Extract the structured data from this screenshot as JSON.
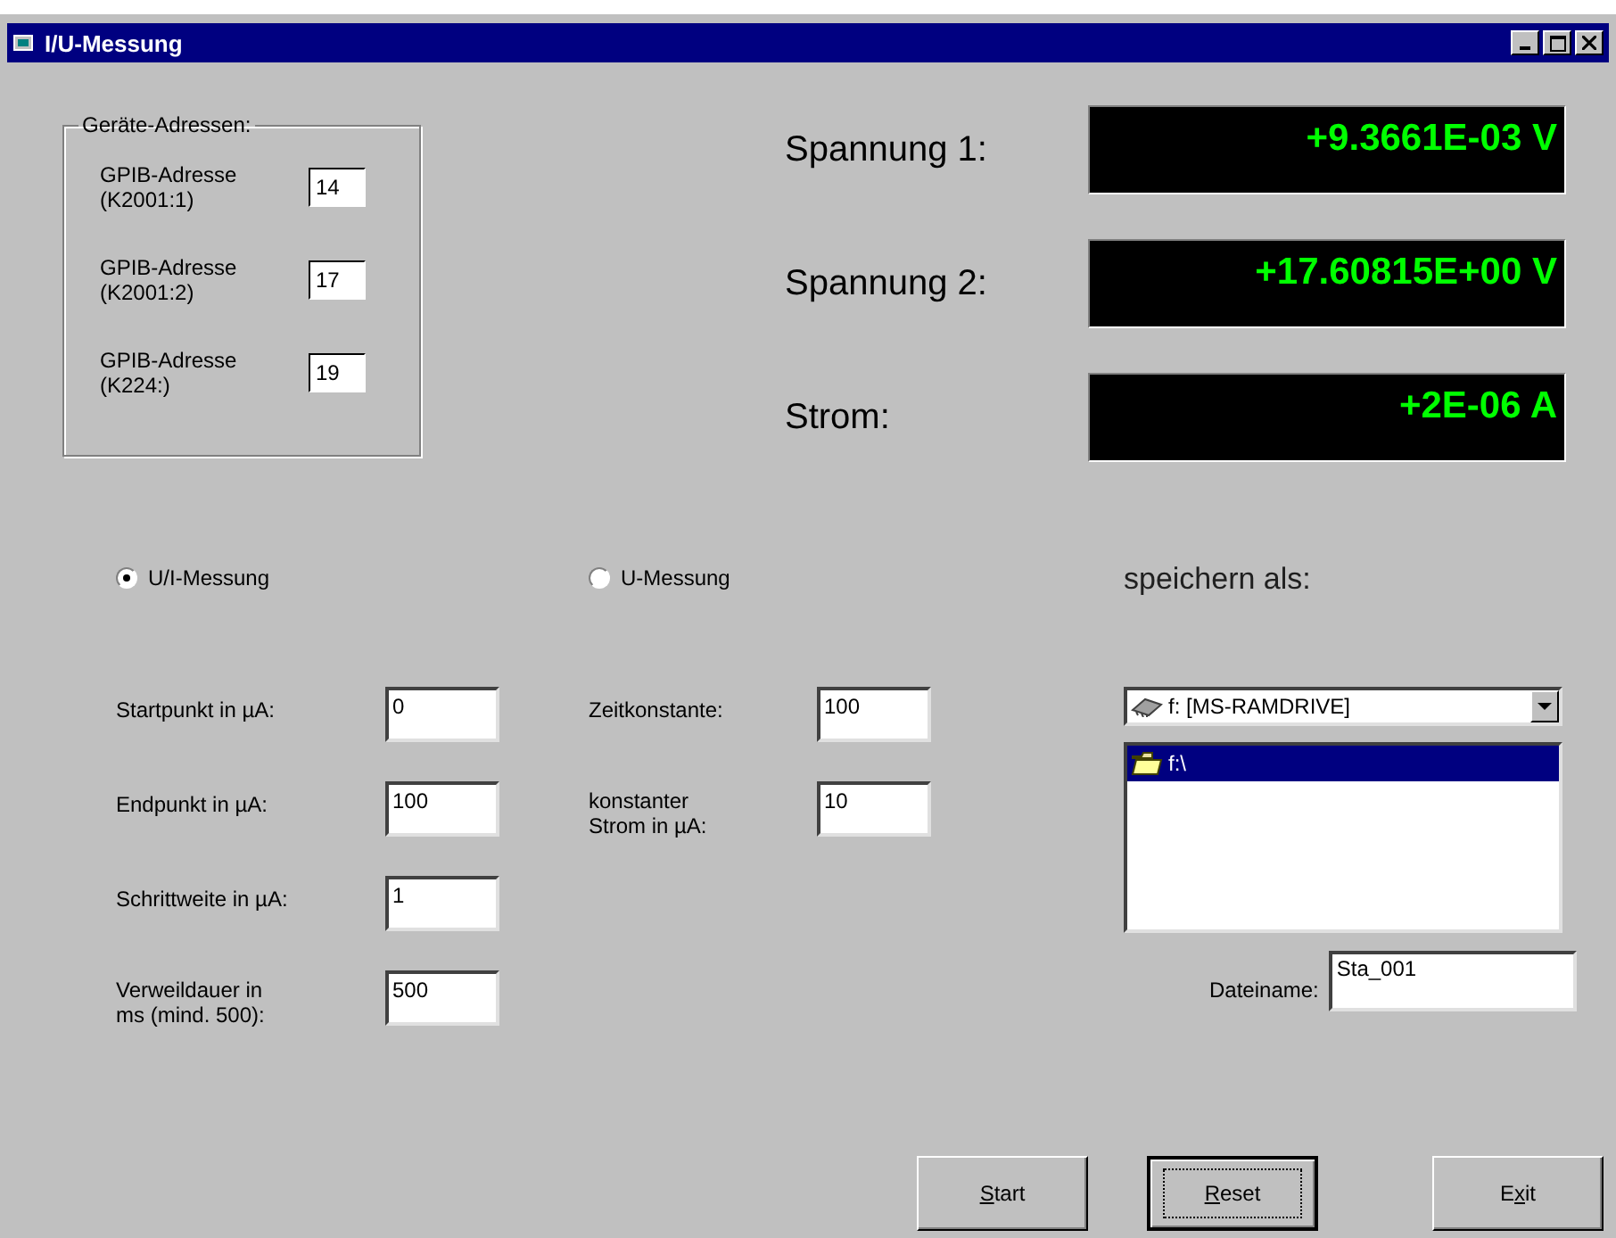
{
  "window": {
    "title": "I/U-Messung"
  },
  "device_addresses": {
    "legend": "Geräte-Adressen:",
    "items": [
      {
        "label_line1": "GPIB-Adresse",
        "label_line2": "(K2001:1)",
        "value": "14"
      },
      {
        "label_line1": "GPIB-Adresse",
        "label_line2": "(K2001:2)",
        "value": "17"
      },
      {
        "label_line1": "GPIB-Adresse",
        "label_line2": "(K224:)",
        "value": "19"
      }
    ]
  },
  "readings": [
    {
      "label": "Spannung 1:",
      "value": "+9.3661E-03 V"
    },
    {
      "label": "Spannung 2:",
      "value": "+17.60815E+00 V"
    },
    {
      "label": "Strom:",
      "value": "+2E-06 A"
    }
  ],
  "modes": [
    {
      "label": "U/I-Messung",
      "selected": true,
      "fields": [
        {
          "kind": "single",
          "label": "Startpunkt in µA:",
          "value": "0"
        },
        {
          "kind": "single",
          "label": "Endpunkt in µA:",
          "value": "100"
        },
        {
          "kind": "single",
          "label": "Schrittweite in µA:",
          "value": "1"
        },
        {
          "kind": "wrapped",
          "label": "Verweildauer in ms  (mind. 500):",
          "value": "500"
        }
      ]
    },
    {
      "label": "U-Messung",
      "selected": false,
      "fields": [
        {
          "kind": "single",
          "label": "Zeitkonstante:",
          "value": "100"
        },
        {
          "kind": "wrapped",
          "label": "konstanter Strom in µA:",
          "value": "10"
        }
      ]
    }
  ],
  "save": {
    "heading": "speichern als:",
    "drive": "f: [MS-RAMDRIVE]",
    "folders": [
      {
        "label": "f:\\",
        "selected": true
      }
    ],
    "filename_label": "Dateiname:",
    "filename": "Sta_001"
  },
  "buttons": [
    {
      "label_parts": [
        {
          "text": "S",
          "underlined": true
        },
        {
          "text": "tart",
          "underlined": false
        }
      ],
      "focused": false
    },
    {
      "label_parts": [
        {
          "text": "R",
          "underlined": true
        },
        {
          "text": "eset",
          "underlined": false
        }
      ],
      "focused": true
    },
    {
      "label_parts": [
        {
          "text": "E",
          "underlined": false
        },
        {
          "text": "x",
          "underlined": true
        },
        {
          "text": "it",
          "underlined": false
        }
      ],
      "focused": false
    }
  ]
}
